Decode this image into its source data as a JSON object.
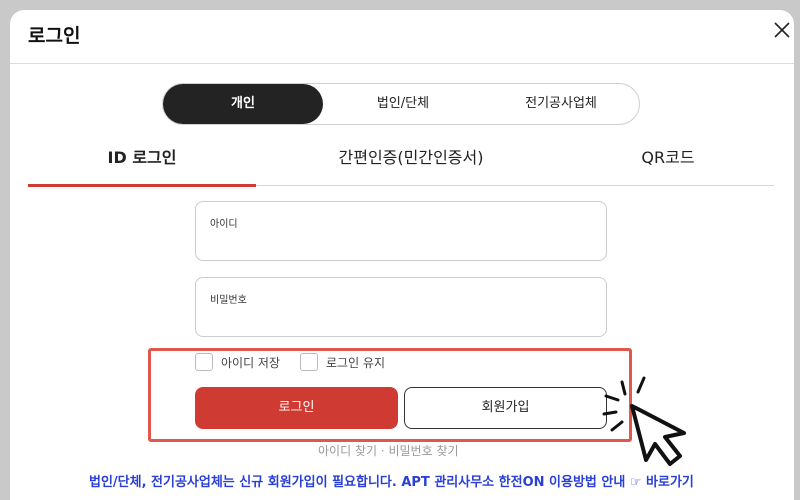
{
  "modal": {
    "title": "로그인"
  },
  "segments": [
    "개인",
    "법인/단체",
    "전기공사업체"
  ],
  "tabs": [
    "ID 로그인",
    "간편인증(민간인증서)",
    "QR코드"
  ],
  "form": {
    "id_label": "아이디",
    "id_value": "",
    "pw_label": "비밀번호",
    "pw_value": ""
  },
  "options": {
    "save_id": "아이디 저장",
    "keep_login": "로그인 유지"
  },
  "buttons": {
    "login": "로그인",
    "join": "회원가입"
  },
  "links": {
    "find_id": "아이디 찾기",
    "separator": " · ",
    "find_pw": "비밀번호 찾기"
  },
  "notice": {
    "text": "법인/단체, 전기공사업체는 신규 회원가입이 필요합니다. APT 관리사무소 한전ON 이용방법 안내 ",
    "link": "☞ 바로가기"
  },
  "colors": {
    "accent": "#cf3a32",
    "dark": "#232323",
    "notice": "#2a3fd6",
    "highlight": "#e2574c"
  }
}
